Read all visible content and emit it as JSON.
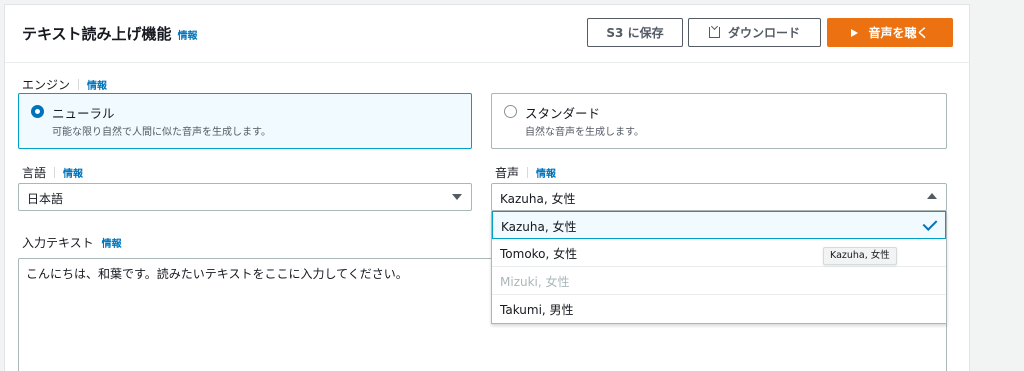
{
  "header": {
    "title": "テキスト読み上げ機能",
    "info": "情報",
    "s3_button": "S3 に保存",
    "download_button": "ダウンロード",
    "listen_button": "音声を聴く"
  },
  "engine": {
    "label": "エンジン",
    "info": "情報",
    "options": [
      {
        "name": "ニューラル",
        "desc": "可能な限り自然で人間に似た音声を生成します。",
        "selected": true
      },
      {
        "name": "スタンダード",
        "desc": "自然な音声を生成します。",
        "selected": false
      }
    ]
  },
  "language": {
    "label": "言語",
    "info": "情報",
    "value": "日本語"
  },
  "voice": {
    "label": "音声",
    "info": "情報",
    "value": "Kazuha, 女性",
    "options": [
      {
        "label": "Kazuha, 女性",
        "state": "selected"
      },
      {
        "label": "Tomoko, 女性",
        "state": "normal"
      },
      {
        "label": "Mizuki, 女性",
        "state": "disabled"
      },
      {
        "label": "Takumi, 男性",
        "state": "normal"
      }
    ],
    "tooltip": "Kazuha, 女性"
  },
  "input": {
    "label": "入力テキスト",
    "info": "情報",
    "text": "こんにちは、和葉です。読みたいテキストをここに入力してください。"
  },
  "colors": {
    "accent": "#ec7211",
    "link": "#0073bb",
    "selected_border": "#00a1c9"
  }
}
